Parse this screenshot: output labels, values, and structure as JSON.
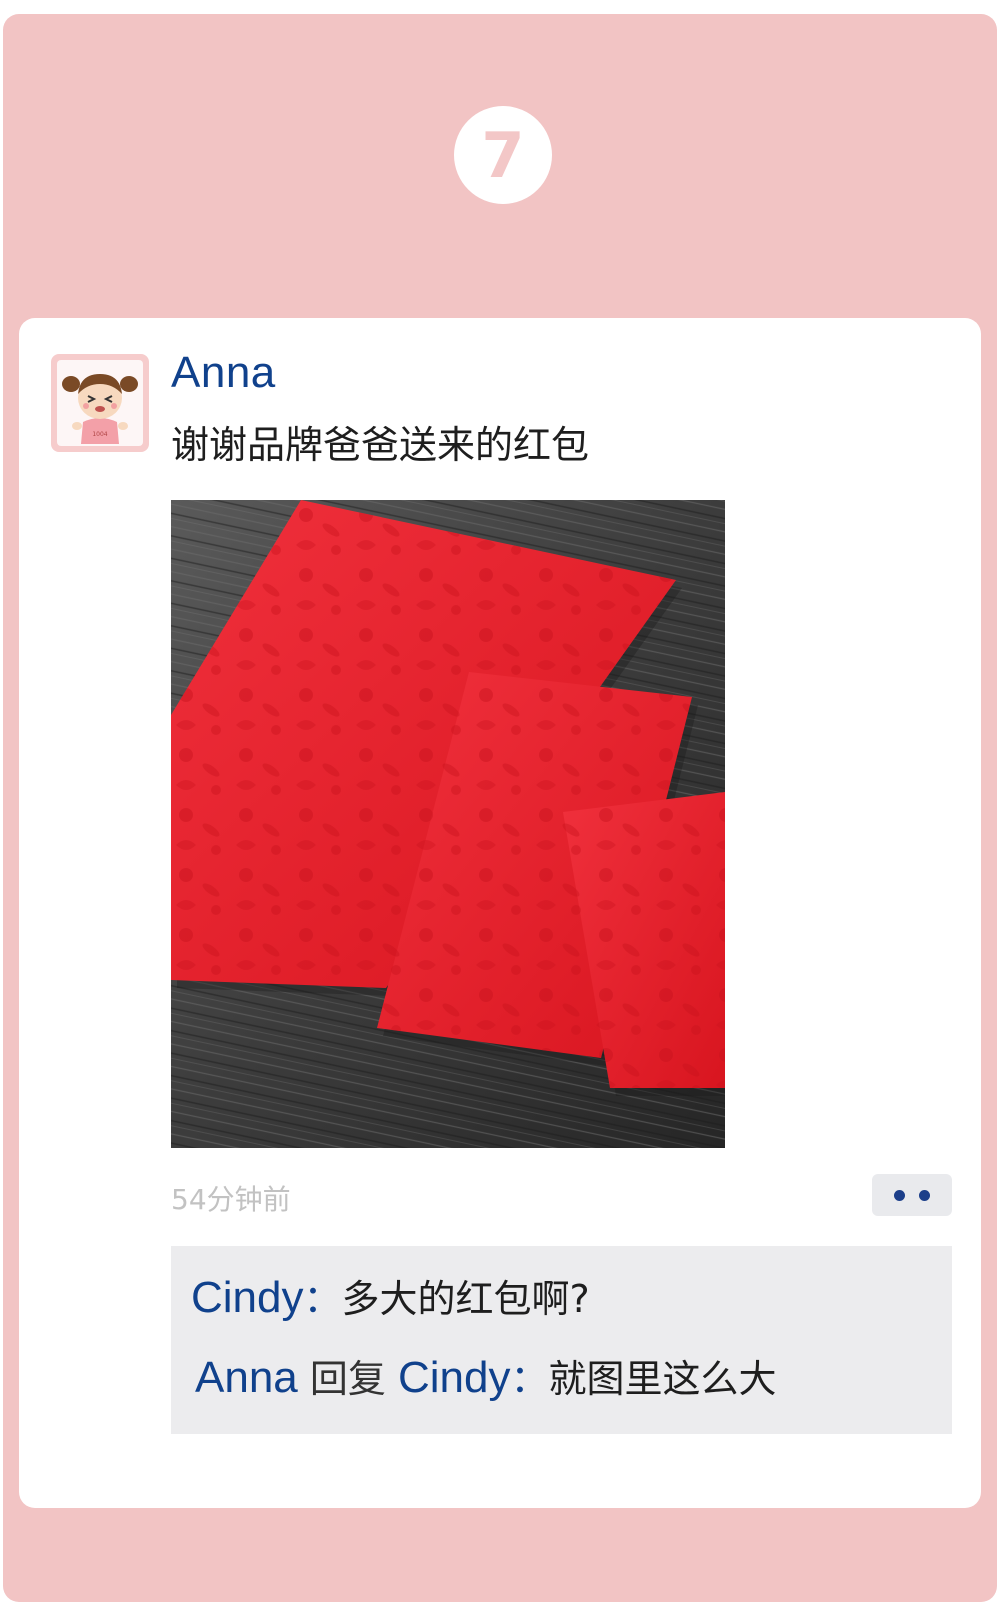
{
  "badge": {
    "number": "7"
  },
  "post": {
    "author": "Anna",
    "text": "谢谢品牌爸爸送来的红包",
    "timestamp": "54分钟前",
    "avatar_label": "1004"
  },
  "comments": [
    {
      "name": "Cindy",
      "separator": "：",
      "text": "多大的红包啊?"
    },
    {
      "name": "Anna",
      "verb": "回复",
      "reply_to": "Cindy",
      "separator": "：",
      "text": "就图里这么大"
    }
  ],
  "icons": {
    "more": "more-dots-icon",
    "avatar": "cartoon-girl-avatar"
  },
  "colors": {
    "background": "#f2c4c4",
    "name_blue": "#10418c",
    "envelope_red": "#e8202e"
  }
}
